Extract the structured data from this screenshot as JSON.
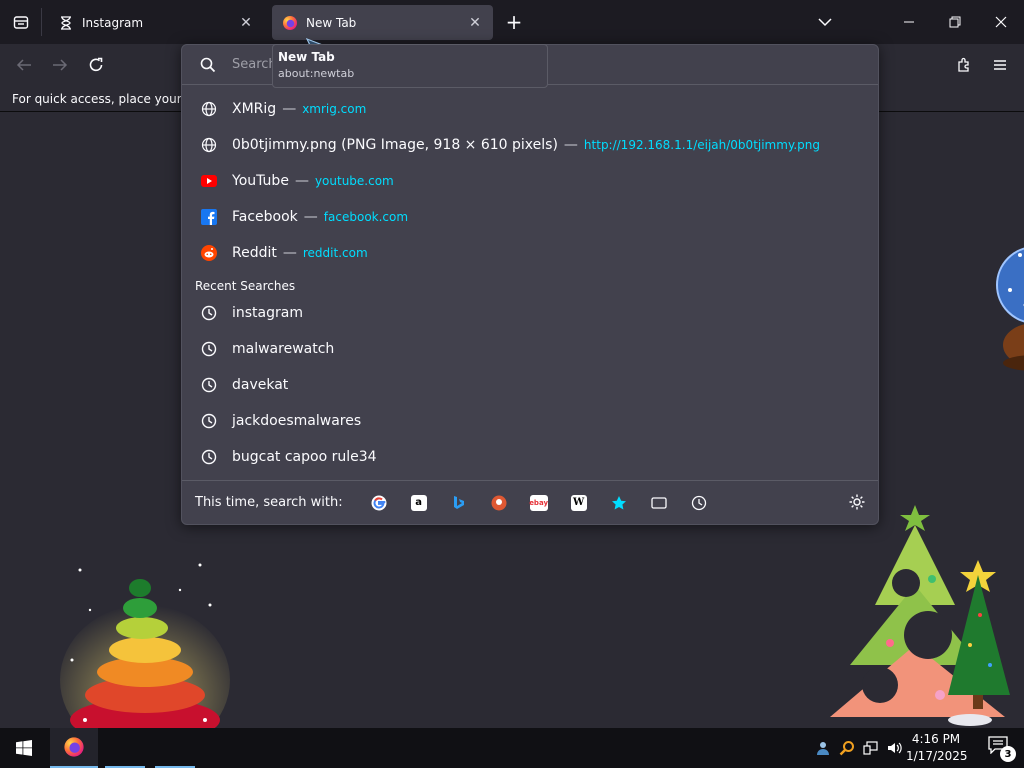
{
  "tabs": [
    {
      "title": "Instagram",
      "favicon": "hourglass-icon"
    },
    {
      "title": "New Tab",
      "favicon": "firefox-icon",
      "selected": true
    }
  ],
  "tooltip": {
    "title": "New Tab",
    "subtitle": "about:newtab"
  },
  "bookmarks_bar": {
    "text": "For quick access, place your boo"
  },
  "urlbar": {
    "placeholder": "Search or enter address",
    "value": ""
  },
  "results": [
    {
      "title": "XMRig",
      "url": "xmrig.com",
      "icon": "globe-icon"
    },
    {
      "title": "0b0tjimmy.png (PNG Image, 918 × 610 pixels)",
      "url": "http://192.168.1.1/eijah/0b0tjimmy.png",
      "icon": "globe-icon"
    },
    {
      "title": "YouTube",
      "url": "youtube.com",
      "icon": "youtube-icon"
    },
    {
      "title": "Facebook",
      "url": "facebook.com",
      "icon": "facebook-icon"
    },
    {
      "title": "Reddit",
      "url": "reddit.com",
      "icon": "reddit-icon"
    }
  ],
  "recent_label": "Recent Searches",
  "recent_searches": [
    "instagram",
    "malwarewatch",
    "davekat",
    "jackdoesmalwares",
    "bugcat capoo rule34"
  ],
  "separator": "—",
  "oneoff": {
    "label": "This time, search with:",
    "engines": [
      "google",
      "amazon",
      "bing",
      "duckduckgo",
      "ebay",
      "wikipedia",
      "bookmarks",
      "tabs",
      "history"
    ]
  },
  "taskbar": {
    "time": "4:16 PM",
    "date": "1/17/2025",
    "notifications": "3"
  },
  "colors": {
    "accent_link": "#00ddff",
    "popup_bg": "#42414d",
    "frame_bg": "#1c1b22"
  }
}
